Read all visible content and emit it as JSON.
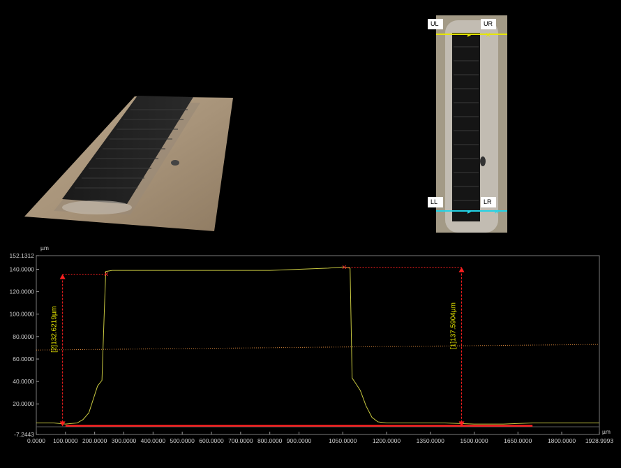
{
  "top_view": {
    "markers": [
      {
        "label": "UL"
      },
      {
        "label": "UR"
      },
      {
        "label": "LL"
      },
      {
        "label": "LR"
      }
    ],
    "upper_line_color": "#e6e600",
    "lower_line_color": "#22d3e6"
  },
  "chart_data": {
    "type": "line",
    "title": "",
    "xlabel": "µm",
    "ylabel": "µm",
    "xlim": [
      0.0,
      1928.9993
    ],
    "ylim": [
      -7.2443,
      152.1312
    ],
    "x_tick_labels": [
      "0.0000",
      "100.0000",
      "200.0000",
      "300.0000",
      "400.0000",
      "500.0000",
      "600.0000",
      "700.0000",
      "800.0000",
      "900.0000",
      "1050.0000",
      "1200.0000",
      "1350.0000",
      "1500.0000",
      "1650.0000",
      "1800.0000",
      "1928.9993"
    ],
    "y_tick_labels": [
      "152.1312",
      "140.0000",
      "120.0000",
      "100.0000",
      "80.0000",
      "60.0000",
      "40.0000",
      "20.0000",
      "-7.2443"
    ],
    "y_ticks": [
      140,
      120,
      100,
      80,
      60,
      40,
      20
    ],
    "grid": false,
    "series": [
      {
        "color": "#c8c840",
        "x": [
          0,
          60,
          100,
          140,
          160,
          180,
          195,
          210,
          225,
          232,
          238,
          260,
          300,
          400,
          500,
          600,
          700,
          800,
          900,
          1000,
          1050,
          1075,
          1082,
          1090,
          1110,
          1130,
          1150,
          1170,
          1200,
          1300,
          1400,
          1500,
          1600,
          1700,
          1800,
          1900,
          1928.9993
        ],
        "y": [
          3,
          3,
          2,
          3,
          6,
          12,
          24,
          36,
          41,
          95,
          138,
          139,
          139,
          139,
          139,
          139,
          139,
          139,
          140,
          141,
          142,
          141,
          43,
          40,
          32,
          18,
          8,
          4,
          3,
          3,
          3,
          2,
          2,
          3,
          3,
          3,
          3
        ]
      }
    ],
    "reference_line": {
      "color": "#d4843a",
      "x": [
        0,
        1928.9993
      ],
      "y": [
        68,
        73
      ]
    },
    "baseline": {
      "color": "#ff2020",
      "x": [
        100,
        1700
      ],
      "y": [
        0.5,
        0.5
      ]
    },
    "annotations": [
      {
        "text": "[1]137.5904µm",
        "x": 1457,
        "y_from": 0,
        "y_to": 141.8
      },
      {
        "text": "[2]132.6219µm",
        "x": 90,
        "y_from": 0,
        "y_to": 135.6
      }
    ],
    "markers": [
      {
        "x": 240,
        "y": 135.6
      },
      {
        "x": 1055,
        "y": 141.8
      }
    ]
  }
}
